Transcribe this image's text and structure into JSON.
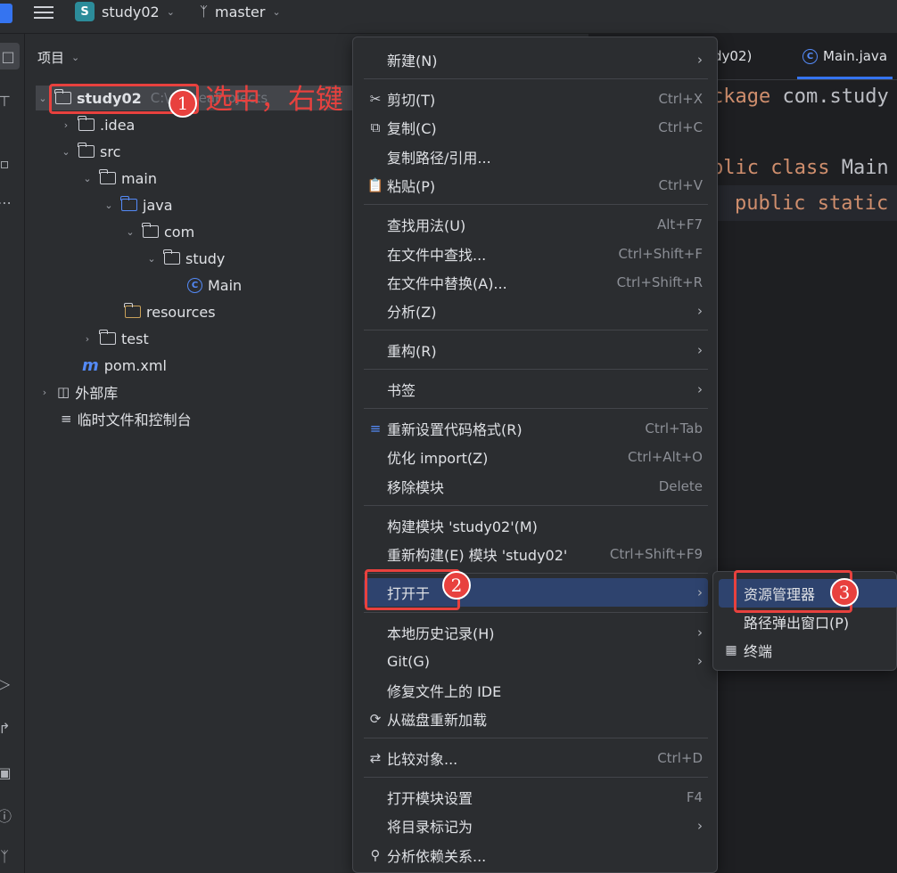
{
  "titlebar": {
    "project_badge": "S",
    "project_name": "study02",
    "branch": "master"
  },
  "project_panel": {
    "header": "项目",
    "tree": [
      {
        "label": "study02",
        "path": "C:\\...\\IdeaProjects"
      },
      {
        "label": ".idea"
      },
      {
        "label": "src"
      },
      {
        "label": "main"
      },
      {
        "label": "java"
      },
      {
        "label": "com"
      },
      {
        "label": "study"
      },
      {
        "label": "Main"
      },
      {
        "label": "resources"
      },
      {
        "label": "test"
      },
      {
        "label": "pom.xml"
      },
      {
        "label": "外部库"
      },
      {
        "label": "临时文件和控制台"
      }
    ]
  },
  "editor": {
    "tabs": [
      {
        "label": "dy02)"
      },
      {
        "label": "Main.java"
      }
    ],
    "code": [
      {
        "kw": "ckage",
        "rest": " com.study"
      },
      {
        "kw": "blic class",
        "rest": " Main"
      },
      {
        "kw": "public static",
        "rest": ""
      }
    ]
  },
  "annotations": {
    "text": "选中，右键",
    "step1": "1",
    "step2": "2",
    "step3": "3"
  },
  "context_menu": {
    "items": [
      {
        "label": "新建(N)",
        "submenu": true
      },
      {
        "label": "剪切(T)",
        "shortcut": "Ctrl+X",
        "icon": "scissors-icon"
      },
      {
        "label": "复制(C)",
        "shortcut": "Ctrl+C",
        "icon": "copy-icon"
      },
      {
        "label": "复制路径/引用..."
      },
      {
        "label": "粘贴(P)",
        "shortcut": "Ctrl+V",
        "icon": "paste-icon"
      },
      {
        "label": "查找用法(U)",
        "shortcut": "Alt+F7"
      },
      {
        "label": "在文件中查找...",
        "shortcut": "Ctrl+Shift+F"
      },
      {
        "label": "在文件中替换(A)...",
        "shortcut": "Ctrl+Shift+R"
      },
      {
        "label": "分析(Z)",
        "submenu": true
      },
      {
        "label": "重构(R)",
        "submenu": true
      },
      {
        "label": "书签",
        "submenu": true
      },
      {
        "label": "重新设置代码格式(R)",
        "shortcut": "Ctrl+Tab",
        "icon": "format-icon"
      },
      {
        "label": "优化 import(Z)",
        "shortcut": "Ctrl+Alt+O"
      },
      {
        "label": "移除模块",
        "shortcut": "Delete"
      },
      {
        "label": "构建模块 'study02'(M)"
      },
      {
        "label": "重新构建(E) 模块 'study02'",
        "shortcut": "Ctrl+Shift+F9"
      },
      {
        "label": "打开于",
        "submenu": true
      },
      {
        "label": "本地历史记录(H)",
        "submenu": true
      },
      {
        "label": "Git(G)",
        "submenu": true
      },
      {
        "label": "修复文件上的 IDE"
      },
      {
        "label": "从磁盘重新加载",
        "icon": "reload-icon"
      },
      {
        "label": "比较对象...",
        "shortcut": "Ctrl+D",
        "icon": "compare-icon"
      },
      {
        "label": "打开模块设置",
        "shortcut": "F4"
      },
      {
        "label": "将目录标记为",
        "submenu": true
      },
      {
        "label": "分析依赖关系...",
        "icon": "dependency-search-icon"
      }
    ],
    "submenu_open_in": [
      {
        "label": "资源管理器"
      },
      {
        "label": "路径弹出窗口(P)"
      },
      {
        "label": "终端",
        "icon": "terminal-icon"
      }
    ]
  }
}
